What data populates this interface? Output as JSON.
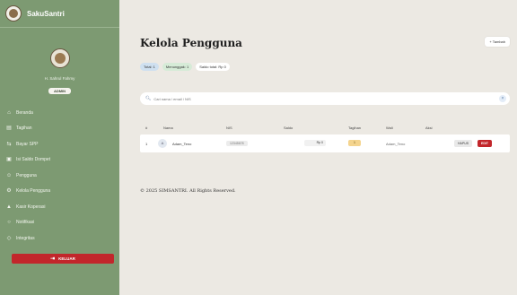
{
  "brand": {
    "name": "SakuSantri"
  },
  "profile": {
    "name": "H. Sahrul Fahmy",
    "role": "ADMIN"
  },
  "sidebar": {
    "items": [
      {
        "label": "Beranda",
        "icon": "home-icon"
      },
      {
        "label": "Tagihan",
        "icon": "file-icon"
      },
      {
        "label": "Bayar SPP",
        "icon": "arrows-icon"
      },
      {
        "label": "Isi Saldo Dompet",
        "icon": "wallet-icon"
      },
      {
        "label": "Pengguna",
        "icon": "users-icon"
      },
      {
        "label": "Kelola Pengguna",
        "icon": "user-settings-icon"
      },
      {
        "label": "Kasir Koperasi",
        "icon": "cashier-icon"
      },
      {
        "label": "Notifikasi",
        "icon": "bell-icon"
      },
      {
        "label": "Integritas",
        "icon": "shield-icon"
      }
    ],
    "logout_label": "KELUAR"
  },
  "main": {
    "title": "Kelola Pengguna",
    "add_button": "+ Tambah",
    "chips": {
      "total": "Total: 1",
      "tunggakan": "Menunggak: 1",
      "saldo": "Saldo total: Rp 0"
    },
    "search": {
      "placeholder": "Cari nama / email / NIS",
      "clear": "×"
    },
    "table": {
      "headers": [
        "#",
        "Nama",
        "NIS",
        "Saldo",
        "Tagihan",
        "Wali",
        "Aksi"
      ],
      "rows": [
        {
          "no": "1",
          "avatar": "A",
          "name": "Adam_Teno",
          "nis": "12345678",
          "saldo": "Rp 0",
          "tagihan": "1",
          "wali": "Adam_Teno",
          "edit": "HAPUS",
          "delete": "EDIT"
        }
      ]
    },
    "footer": "© 2025 SIMSANTRI. All Rights Reserved."
  }
}
